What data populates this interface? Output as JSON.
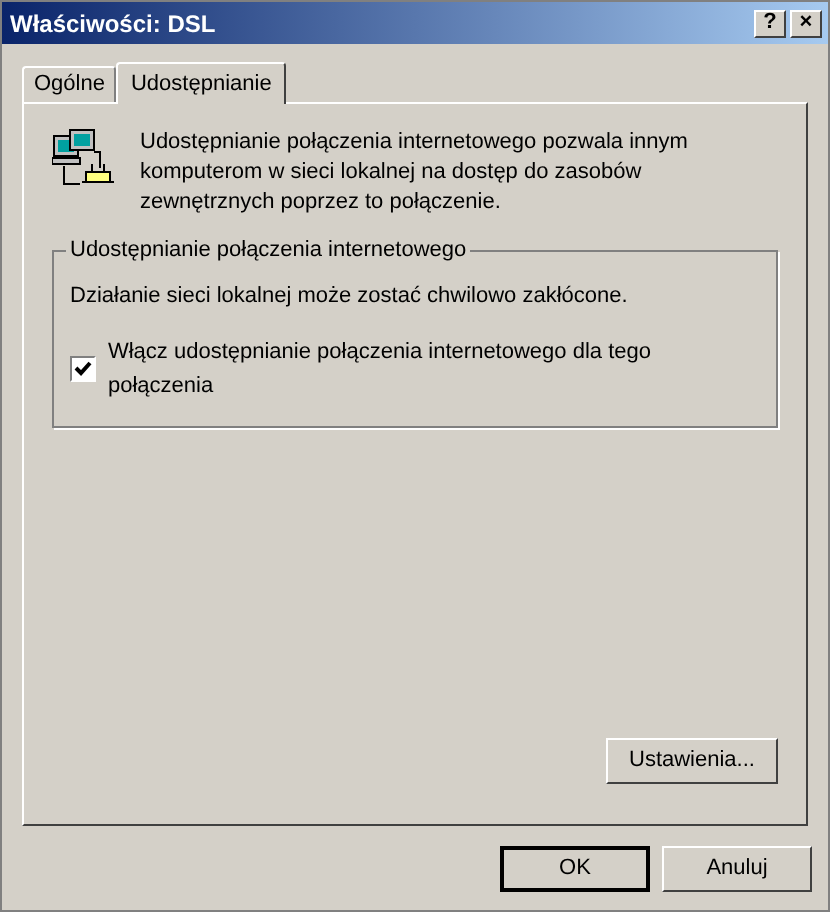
{
  "window": {
    "title": "Właściwości: DSL",
    "title_buttons": [
      "?",
      "×"
    ]
  },
  "tabs": [
    {
      "label": "Ogólne",
      "selected": false
    },
    {
      "label": "Udostępnianie",
      "selected": true
    }
  ],
  "intro": "Udostępnianie połączenia internetowego pozwala innym komputerom w sieci lokalnej na dostęp do zasobów zewnętrznych poprzez to połączenie.",
  "group": {
    "title": "Udostępnianie połączenia internetowego",
    "note": "Działanie sieci lokalnej może zostać chwilowo zakłócone.",
    "checkbox": {
      "label": "Włącz udostępnianie połączenia internetowego dla tego połączenia",
      "checked": true
    }
  },
  "settings_button": "Ustawienia...",
  "buttons": [
    {
      "label": "OK",
      "default": true
    },
    {
      "label": "Anuluj",
      "default": false
    }
  ]
}
